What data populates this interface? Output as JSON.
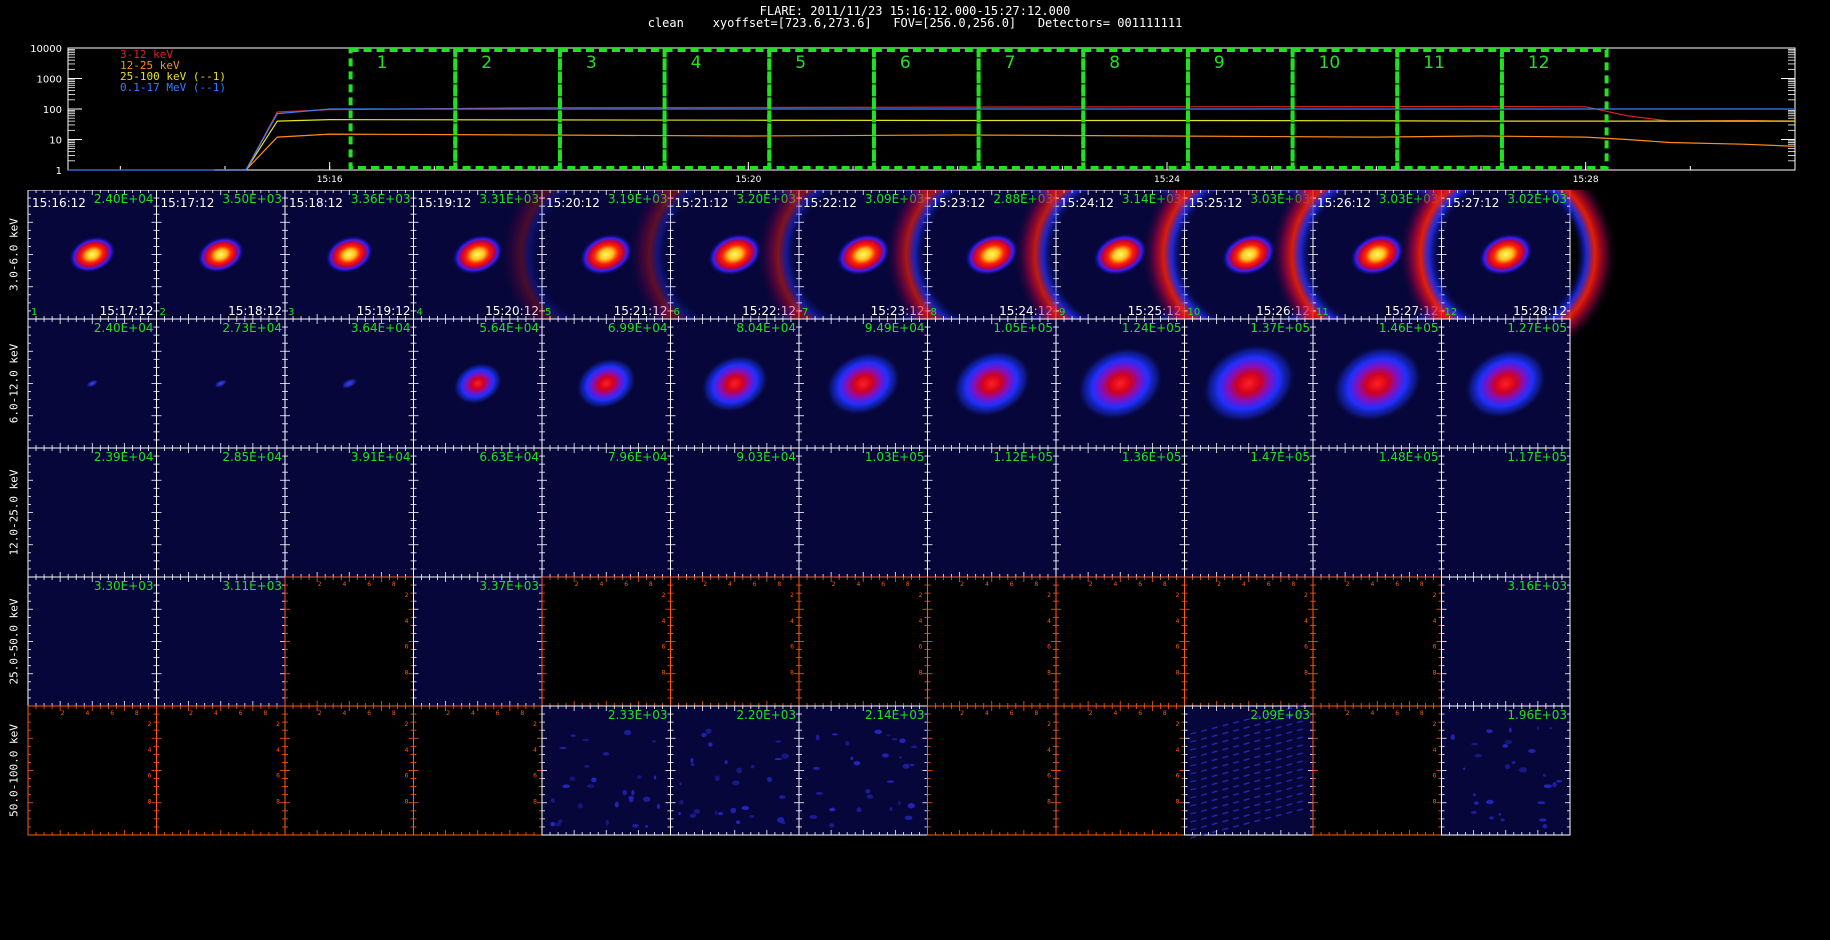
{
  "header": {
    "title": "FLARE: 2011/11/23 15:16:12.000-15:27:12.000",
    "info": "clean    xyoffset=[723.6,273.6]   FOV=[256.0,256.0]   Detectors= 001111111"
  },
  "colors": {
    "lc_3_12": "#e02020",
    "lc_12_25": "#ff8c1a",
    "lc_25_100": "#e8e020",
    "lc_01_17": "#3a7dff",
    "interval_box": "#22e022",
    "peak_label": "#22e022",
    "empty_frame": "#ff5a10",
    "map_background": "#06063a"
  },
  "chart_data": [
    {
      "type": "line",
      "title": "",
      "ylabel": "",
      "scale": "log",
      "ylim": [
        1,
        10000
      ],
      "y_ticks": [
        "10000",
        "1000",
        "100",
        "10",
        "1"
      ],
      "x_ticks": [
        "15:16",
        "15:20",
        "15:24",
        "15:28"
      ],
      "legend": [
        {
          "text": "3-12 keV",
          "color_key": "lc_3_12"
        },
        {
          "text": "12-25 keV",
          "color_key": "lc_12_25"
        },
        {
          "text": "25-100 keV (--1)",
          "color_key": "lc_25_100"
        },
        {
          "text": "0.1-17 MeV (--1)",
          "color_key": "lc_01_17"
        }
      ],
      "series": [
        {
          "name": "3-12 keV",
          "t_min": [
            14.9,
            15.2,
            15.5,
            16.0,
            18.0,
            20.0,
            22.0,
            24.0,
            26.0,
            27.0,
            28.0,
            28.4,
            28.8,
            29.5,
            30.0
          ],
          "values": [
            1,
            1,
            80,
            95,
            110,
            112,
            115,
            118,
            120,
            122,
            118,
            60,
            40,
            42,
            40
          ]
        },
        {
          "name": "12-25 keV",
          "t_min": [
            14.9,
            15.2,
            15.5,
            16.0,
            18.0,
            20.0,
            22.0,
            24.0,
            26.0,
            27.0,
            28.0,
            28.4,
            28.8,
            29.5,
            30.0
          ],
          "values": [
            1,
            1,
            12,
            15,
            14,
            13,
            14,
            13,
            12,
            13,
            12,
            10,
            8,
            7,
            6
          ]
        },
        {
          "name": "25-100 keV (--1)",
          "t_min": [
            14.9,
            15.2,
            15.5,
            16.0,
            18.0,
            20.0,
            22.0,
            24.0,
            26.0,
            27.0,
            28.0,
            28.4,
            28.8,
            29.5,
            30.0
          ],
          "values": [
            1,
            1,
            40,
            45,
            44,
            43,
            42,
            42,
            41,
            40,
            40,
            40,
            40,
            40,
            40
          ]
        },
        {
          "name": "0.1-17 MeV (--1)",
          "t_min": [
            13.5,
            14.0,
            15.0,
            15.2,
            15.5,
            16.0,
            20.0,
            24.0,
            28.0,
            29.0,
            30.0
          ],
          "values": [
            1,
            1,
            1,
            1,
            70,
            100,
            100,
            100,
            100,
            100,
            100
          ]
        }
      ],
      "x_range_min": [
        13.5,
        30.0
      ],
      "intervals": [
        {
          "label": "1",
          "start_min": 16.2,
          "end_min": 17.2
        },
        {
          "label": "2",
          "start_min": 17.2,
          "end_min": 18.2
        },
        {
          "label": "3",
          "start_min": 18.2,
          "end_min": 19.2
        },
        {
          "label": "4",
          "start_min": 19.2,
          "end_min": 20.2
        },
        {
          "label": "5",
          "start_min": 20.2,
          "end_min": 21.2
        },
        {
          "label": "6",
          "start_min": 21.2,
          "end_min": 22.2
        },
        {
          "label": "7",
          "start_min": 22.2,
          "end_min": 23.2
        },
        {
          "label": "8",
          "start_min": 23.2,
          "end_min": 24.2
        },
        {
          "label": "9",
          "start_min": 24.2,
          "end_min": 25.2
        },
        {
          "label": "10",
          "start_min": 25.2,
          "end_min": 26.2
        },
        {
          "label": "11",
          "start_min": 26.2,
          "end_min": 27.2
        },
        {
          "label": "12",
          "start_min": 27.2,
          "end_min": 28.2
        }
      ]
    },
    {
      "type": "heatmap",
      "title": "",
      "rows": [
        {
          "label": "3.0-6.0 keV"
        },
        {
          "label": "6.0-12.0 keV"
        },
        {
          "label": "12.0-25.0 keV"
        },
        {
          "label": "25.0-50.0 keV"
        },
        {
          "label": "50.0-100.0 keV"
        }
      ],
      "columns": [
        {
          "index": "1",
          "start": "15:16:12",
          "end": "15:17:12"
        },
        {
          "index": "2",
          "start": "15:17:12",
          "end": "15:18:12"
        },
        {
          "index": "3",
          "start": "15:18:12",
          "end": "15:19:12"
        },
        {
          "index": "4",
          "start": "15:19:12",
          "end": "15:20:12"
        },
        {
          "index": "5",
          "start": "15:20:12",
          "end": "15:21:12"
        },
        {
          "index": "6",
          "start": "15:21:12",
          "end": "15:22:12"
        },
        {
          "index": "7",
          "start": "15:22:12",
          "end": "15:23:12"
        },
        {
          "index": "8",
          "start": "15:23:12",
          "end": "15:24:12"
        },
        {
          "index": "9",
          "start": "15:24:12",
          "end": "15:25:12"
        },
        {
          "index": "10",
          "start": "15:25:12",
          "end": "15:26:12"
        },
        {
          "index": "11",
          "start": "15:26:12",
          "end": "15:27:12"
        },
        {
          "index": "12",
          "start": "15:27:12",
          "end": "15:28:12"
        }
      ],
      "empty_tick_labels": [
        "2",
        "4",
        "6",
        "8"
      ],
      "cells": [
        [
          {
            "peak": "2.40E+04",
            "source": "core",
            "size": 0.45,
            "level": 0.9
          },
          {
            "peak": "3.50E+03",
            "source": "core",
            "size": 0.45,
            "level": 0.9
          },
          {
            "peak": "3.36E+03",
            "source": "core",
            "size": 0.48,
            "level": 0.9
          },
          {
            "peak": "3.31E+03",
            "source": "core",
            "size": 0.55,
            "level": 0.95
          },
          {
            "peak": "3.19E+03",
            "source": "core",
            "size": 0.6,
            "level": 0.97,
            "halo": 0.3
          },
          {
            "peak": "3.20E+03",
            "source": "core",
            "size": 0.62,
            "level": 1.0,
            "halo": 0.4
          },
          {
            "peak": "3.09E+03",
            "source": "core",
            "size": 0.62,
            "level": 1.0,
            "halo": 0.55
          },
          {
            "peak": "2.88E+03",
            "source": "core",
            "size": 0.62,
            "level": 1.0,
            "halo": 0.75
          },
          {
            "peak": "3.14E+03",
            "source": "core",
            "size": 0.62,
            "level": 1.0,
            "halo": 0.85
          },
          {
            "peak": "3.03E+03",
            "source": "core",
            "size": 0.62,
            "level": 1.0,
            "halo": 0.95
          },
          {
            "peak": "3.03E+03",
            "source": "core",
            "size": 0.62,
            "level": 1.0,
            "halo": 0.95
          },
          {
            "peak": "3.02E+03",
            "source": "core",
            "size": 0.62,
            "level": 1.0,
            "halo": 1.0
          }
        ],
        [
          {
            "peak": "2.40E+04",
            "source": "faint",
            "size": 0.1,
            "level": 0.3
          },
          {
            "peak": "2.73E+04",
            "source": "faint",
            "size": 0.12,
            "level": 0.35
          },
          {
            "peak": "3.64E+04",
            "source": "faint",
            "size": 0.2,
            "level": 0.45
          },
          {
            "peak": "5.64E+04",
            "source": "diffuse",
            "size": 0.4,
            "level": 0.65
          },
          {
            "peak": "6.99E+04",
            "source": "diffuse",
            "size": 0.55,
            "level": 0.75
          },
          {
            "peak": "8.04E+04",
            "source": "diffuse",
            "size": 0.65,
            "level": 0.8
          },
          {
            "peak": "9.49E+04",
            "source": "diffuse",
            "size": 0.75,
            "level": 0.85
          },
          {
            "peak": "1.05E+05",
            "source": "diffuse",
            "size": 0.8,
            "level": 0.88
          },
          {
            "peak": "1.24E+05",
            "source": "diffuse",
            "size": 0.9,
            "level": 0.9
          },
          {
            "peak": "1.37E+05",
            "source": "diffuse",
            "size": 1.0,
            "level": 0.95
          },
          {
            "peak": "1.46E+05",
            "source": "diffuse",
            "size": 0.95,
            "level": 0.92
          },
          {
            "peak": "1.27E+05",
            "source": "diffuse",
            "size": 0.85,
            "level": 0.88
          }
        ],
        [
          {
            "peak": "2.39E+04",
            "source": "none"
          },
          {
            "peak": "2.85E+04",
            "source": "none"
          },
          {
            "peak": "3.91E+04",
            "source": "none"
          },
          {
            "peak": "6.63E+04",
            "source": "none"
          },
          {
            "peak": "7.96E+04",
            "source": "none"
          },
          {
            "peak": "9.03E+04",
            "source": "none"
          },
          {
            "peak": "1.03E+05",
            "source": "none"
          },
          {
            "peak": "1.12E+05",
            "source": "none"
          },
          {
            "peak": "1.36E+05",
            "source": "none"
          },
          {
            "peak": "1.47E+05",
            "source": "none"
          },
          {
            "peak": "1.48E+05",
            "source": "none"
          },
          {
            "peak": "1.17E+05",
            "source": "none"
          }
        ],
        [
          {
            "peak": "3.30E+03",
            "source": "none"
          },
          {
            "peak": "3.11E+03",
            "source": "none"
          },
          {
            "peak": "",
            "source": "empty"
          },
          {
            "peak": "3.37E+03",
            "source": "none"
          },
          {
            "peak": "",
            "source": "empty"
          },
          {
            "peak": "",
            "source": "empty"
          },
          {
            "peak": "",
            "source": "empty"
          },
          {
            "peak": "",
            "source": "empty"
          },
          {
            "peak": "",
            "source": "empty"
          },
          {
            "peak": "",
            "source": "empty"
          },
          {
            "peak": "",
            "source": "empty"
          },
          {
            "peak": "3.16E+03",
            "source": "none"
          }
        ],
        [
          {
            "peak": "",
            "source": "empty"
          },
          {
            "peak": "",
            "source": "empty"
          },
          {
            "peak": "",
            "source": "empty"
          },
          {
            "peak": "",
            "source": "empty"
          },
          {
            "peak": "2.33E+03",
            "source": "noise"
          },
          {
            "peak": "2.20E+03",
            "source": "noise"
          },
          {
            "peak": "2.14E+03",
            "source": "noise"
          },
          {
            "peak": "",
            "source": "empty"
          },
          {
            "peak": "",
            "source": "empty"
          },
          {
            "peak": "2.09E+03",
            "source": "streaks"
          },
          {
            "peak": "",
            "source": "empty"
          },
          {
            "peak": "1.96E+03",
            "source": "noise"
          }
        ]
      ]
    }
  ]
}
